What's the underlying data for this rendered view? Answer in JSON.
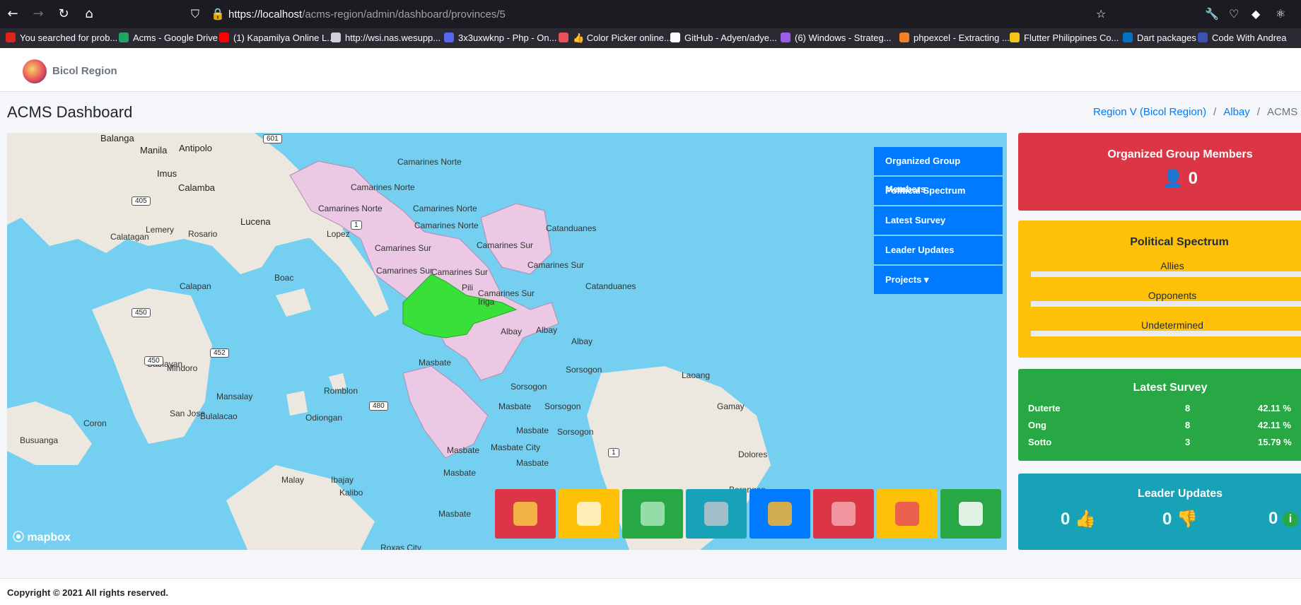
{
  "browser": {
    "url_host": "https://localhost",
    "url_path": "/acms-region/admin/dashboard/provinces/5",
    "bookmarks": [
      {
        "label": "You searched for prob...",
        "color": "#e2231a"
      },
      {
        "label": "Acms - Google Drive",
        "color": "#1fa463"
      },
      {
        "label": "(1) Kapamilya Online L...",
        "color": "#ff0000"
      },
      {
        "label": "http://wsi.nas.wesupp...",
        "color": "#cfcfd8"
      },
      {
        "label": "3x3uxwknp - Php - On...",
        "color": "#5865f2"
      },
      {
        "label": "👍 Color Picker online...",
        "color": "#e8505b"
      },
      {
        "label": "GitHub - Adyen/adye...",
        "color": "#fbfbfe"
      },
      {
        "label": "(6) Windows - Strateg...",
        "color": "#9b5de5"
      },
      {
        "label": "phpexcel - Extracting ...",
        "color": "#f48024"
      },
      {
        "label": "Flutter Philippines Co...",
        "color": "#f5c518"
      },
      {
        "label": "Dart packages",
        "color": "#0175c2"
      },
      {
        "label": "Code With Andrea",
        "color": "#3f51b5"
      }
    ]
  },
  "navbar": {
    "brand": "Bicol Region"
  },
  "page": {
    "title": "ACMS Dashboard",
    "breadcrumb": [
      "Region V (Bicol Region)",
      "Albay",
      "ACMS Da"
    ]
  },
  "map": {
    "menu": [
      "Organized Group Members",
      "Political Spectrum",
      "Latest Survey",
      "Leader Updates",
      "Projects ▾"
    ],
    "attribution": "mapbox",
    "labels": [
      {
        "text": "Balanga",
        "cls": "city"
      },
      {
        "text": "Manila",
        "cls": "city"
      },
      {
        "text": "Antipolo",
        "cls": "city"
      },
      {
        "text": "Imus",
        "cls": "city"
      },
      {
        "text": "Calamba",
        "cls": "city"
      },
      {
        "text": "Lucena",
        "cls": "city"
      },
      {
        "text": "Lemery",
        "cls": ""
      },
      {
        "text": "Rosario",
        "cls": ""
      },
      {
        "text": "Calatagan",
        "cls": ""
      },
      {
        "text": "Lopez",
        "cls": ""
      },
      {
        "text": "Calapan",
        "cls": ""
      },
      {
        "text": "Boac",
        "cls": ""
      },
      {
        "text": "Pili",
        "cls": ""
      },
      {
        "text": "Iriga",
        "cls": ""
      },
      {
        "text": "Sablayan",
        "cls": ""
      },
      {
        "text": "Mindoro",
        "cls": ""
      },
      {
        "text": "Mansalay",
        "cls": ""
      },
      {
        "text": "San Jose",
        "cls": ""
      },
      {
        "text": "Bulalacao",
        "cls": ""
      },
      {
        "text": "Coron",
        "cls": ""
      },
      {
        "text": "Busuanga",
        "cls": ""
      },
      {
        "text": "Odiongan",
        "cls": ""
      },
      {
        "text": "Romblon",
        "cls": ""
      },
      {
        "text": "Malay",
        "cls": ""
      },
      {
        "text": "Ibajay",
        "cls": ""
      },
      {
        "text": "Kalibo",
        "cls": ""
      },
      {
        "text": "Roxas City",
        "cls": ""
      },
      {
        "text": "Laoang",
        "cls": ""
      },
      {
        "text": "Gamay",
        "cls": ""
      },
      {
        "text": "Dolores",
        "cls": ""
      },
      {
        "text": "Borongan",
        "cls": ""
      },
      {
        "text": "Camarines Norte",
        "cls": ""
      },
      {
        "text": "Camarines Norte",
        "cls": ""
      },
      {
        "text": "Camarines Norte",
        "cls": ""
      },
      {
        "text": "Camarines Norte",
        "cls": ""
      },
      {
        "text": "Camarines Norte",
        "cls": ""
      },
      {
        "text": "Camarines Sur",
        "cls": ""
      },
      {
        "text": "Camarines Sur",
        "cls": ""
      },
      {
        "text": "Camarines Sur",
        "cls": ""
      },
      {
        "text": "Camarines Sur",
        "cls": ""
      },
      {
        "text": "Camarines Sur",
        "cls": ""
      },
      {
        "text": "Camarines Sur",
        "cls": ""
      },
      {
        "text": "Catanduanes",
        "cls": ""
      },
      {
        "text": "Catanduanes",
        "cls": ""
      },
      {
        "text": "Albay",
        "cls": ""
      },
      {
        "text": "Albay",
        "cls": ""
      },
      {
        "text": "Albay",
        "cls": ""
      },
      {
        "text": "Sorsogon",
        "cls": ""
      },
      {
        "text": "Sorsogon",
        "cls": ""
      },
      {
        "text": "Sorsogon",
        "cls": ""
      },
      {
        "text": "Sorsogon",
        "cls": ""
      },
      {
        "text": "Masbate",
        "cls": ""
      },
      {
        "text": "Masbate",
        "cls": ""
      },
      {
        "text": "Masbate",
        "cls": ""
      },
      {
        "text": "Masbate City",
        "cls": ""
      },
      {
        "text": "Masbate",
        "cls": ""
      },
      {
        "text": "Masbate",
        "cls": ""
      },
      {
        "text": "Masbate",
        "cls": ""
      },
      {
        "text": "Masbate",
        "cls": ""
      }
    ],
    "road_shields": [
      "601",
      "405",
      "450",
      "450",
      "452",
      "480",
      "1",
      "1"
    ],
    "tiles": [
      {
        "name": "map-pin-tile",
        "color": "#dc3545",
        "glyph": "#f7c948"
      },
      {
        "name": "government-building-tile",
        "color": "#ffc107",
        "glyph": "#fff7d6"
      },
      {
        "name": "chart-grid-tile",
        "color": "#28a745",
        "glyph": "#a8e6b8"
      },
      {
        "name": "tag-tile",
        "color": "#17a2b8",
        "glyph": "#b8c4cc"
      },
      {
        "name": "lightbulb-gear-tile",
        "color": "#007bff",
        "glyph": "#f7b731"
      },
      {
        "name": "ballot-box-tile",
        "color": "#dc3545",
        "glyph": "#f3a6ae"
      },
      {
        "name": "climber-tile",
        "color": "#ffc107",
        "glyph": "#e8505b"
      },
      {
        "name": "mountain-tile",
        "color": "#28a745",
        "glyph": "#ffffff"
      }
    ]
  },
  "cards": {
    "ogm": {
      "title": "Organized Group Members",
      "count": "0",
      "color": "#dc3545"
    },
    "spectrum": {
      "title": "Political Spectrum",
      "color": "#ffc107",
      "bars": [
        {
          "label": "Allies",
          "value": 0
        },
        {
          "label": "Opponents",
          "value": 0
        },
        {
          "label": "Undetermined",
          "value": 0
        }
      ]
    },
    "survey": {
      "title": "Latest Survey",
      "color": "#28a745",
      "rows": [
        {
          "name": "Duterte",
          "count": "8",
          "pct": "42.11 %"
        },
        {
          "name": "Ong",
          "count": "8",
          "pct": "42.11 %"
        },
        {
          "name": "Sotto",
          "count": "3",
          "pct": "15.79 %"
        }
      ]
    },
    "leader": {
      "title": "Leader Updates",
      "color": "#17a2b8",
      "items": [
        {
          "count": "0",
          "icon": "thumbs-up-icon"
        },
        {
          "count": "0",
          "icon": "thumbs-down-icon"
        },
        {
          "count": "0",
          "icon": "info-icon"
        }
      ]
    }
  },
  "footer": {
    "text": "Copyright © 2021 All rights reserved."
  }
}
